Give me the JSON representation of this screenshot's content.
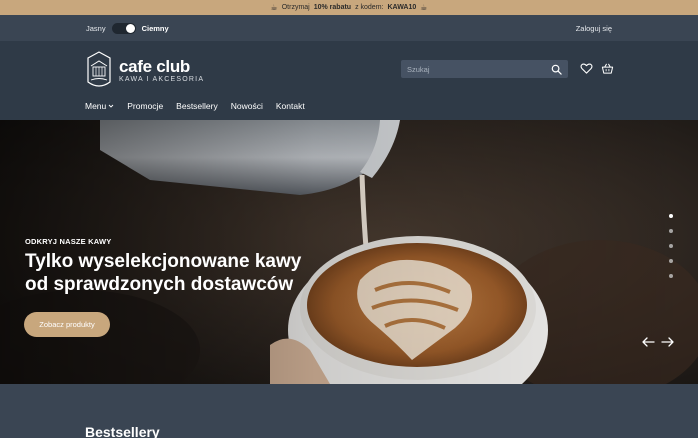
{
  "promo": {
    "prefix": "Otrzymaj",
    "discount": "10% rabatu",
    "middle": "z kodem:",
    "code": "KAWA10"
  },
  "topbar": {
    "theme_light": "Jasny",
    "theme_dark": "Ciemny",
    "theme_selected": "Ciemny",
    "login": "Zaloguj się"
  },
  "header": {
    "brand": "cafe club",
    "tagline": "KAWA I AKCESORIA",
    "search_placeholder": "Szukaj"
  },
  "nav": {
    "items": [
      "Menu",
      "Promocje",
      "Bestsellery",
      "Nowości",
      "Kontakt"
    ]
  },
  "hero": {
    "eyebrow": "ODKRYJ NASZE KAWY",
    "title_line1": "Tylko wyselekcjonowane kawy",
    "title_line2": "od sprawdzonych dostawców",
    "cta": "Zobacz produkty",
    "slide_count": 5,
    "active_slide": 1
  },
  "section": {
    "title": "Bestsellery"
  },
  "colors": {
    "accent": "#c8a77d",
    "header_bg": "#2f3a47",
    "topbar_bg": "#3a4553"
  }
}
